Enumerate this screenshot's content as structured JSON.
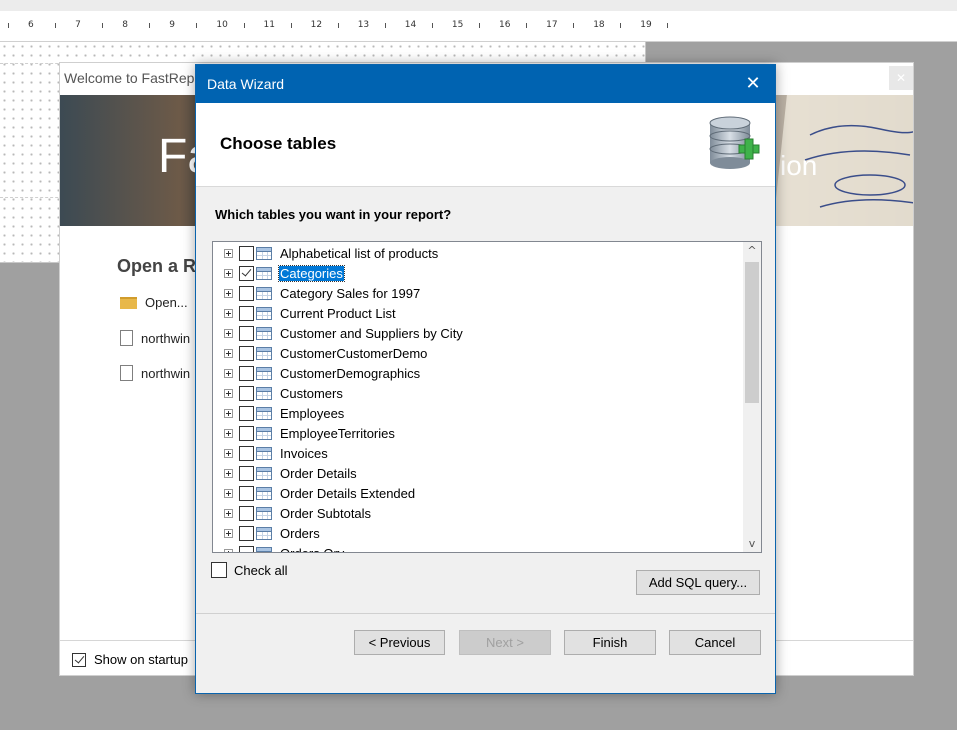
{
  "ruler": {
    "numbers": [
      "6",
      "7",
      "8",
      "9",
      "10",
      "11",
      "12",
      "13",
      "14",
      "15",
      "16",
      "17",
      "18",
      "19"
    ]
  },
  "welcome": {
    "title": "Welcome to FastRep",
    "banner_left": "Fa",
    "banner_right": "ion",
    "open_heading": "Open a R",
    "recent": [
      {
        "label": "Open...",
        "icon": "folder-icon"
      },
      {
        "label": "northwin",
        "icon": "file-icon"
      },
      {
        "label": "northwin",
        "icon": "file-icon"
      }
    ],
    "show_on_startup": "Show on startup",
    "show_on_startup_checked": true
  },
  "wizard": {
    "title": "Data Wizard",
    "close_glyph": "✕",
    "heading": "Choose tables",
    "question": "Which tables you want in your report?",
    "tables": [
      {
        "name": "Alphabetical list of products",
        "checked": false,
        "selected": false
      },
      {
        "name": "Categories",
        "checked": true,
        "selected": true
      },
      {
        "name": "Category Sales for 1997",
        "checked": false,
        "selected": false
      },
      {
        "name": "Current Product List",
        "checked": false,
        "selected": false
      },
      {
        "name": "Customer and Suppliers by City",
        "checked": false,
        "selected": false
      },
      {
        "name": "CustomerCustomerDemo",
        "checked": false,
        "selected": false
      },
      {
        "name": "CustomerDemographics",
        "checked": false,
        "selected": false
      },
      {
        "name": "Customers",
        "checked": false,
        "selected": false
      },
      {
        "name": "Employees",
        "checked": false,
        "selected": false
      },
      {
        "name": "EmployeeTerritories",
        "checked": false,
        "selected": false
      },
      {
        "name": "Invoices",
        "checked": false,
        "selected": false
      },
      {
        "name": "Order Details",
        "checked": false,
        "selected": false
      },
      {
        "name": "Order Details Extended",
        "checked": false,
        "selected": false
      },
      {
        "name": "Order Subtotals",
        "checked": false,
        "selected": false
      },
      {
        "name": "Orders",
        "checked": false,
        "selected": false
      },
      {
        "name": "Orders Qry",
        "checked": false,
        "selected": false
      }
    ],
    "check_all": "Check all",
    "add_sql": "Add SQL query...",
    "buttons": {
      "previous": "< Previous",
      "next": "Next >",
      "finish": "Finish",
      "cancel": "Cancel"
    },
    "scroll_up_glyph": "^",
    "scroll_down_glyph": "v",
    "accent": "#0063b1",
    "selection": "#0078d7"
  }
}
